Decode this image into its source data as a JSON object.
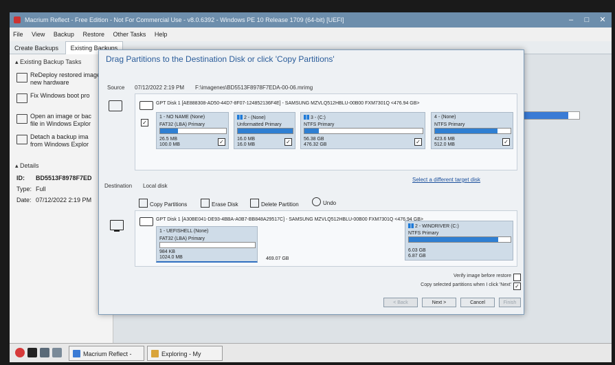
{
  "window": {
    "title": "Macrium Reflect - Free Edition - Not For Commercial Use - v8.0.6392 - Windows PE 10 Release 1709 (64-bit) [UEFI]",
    "controls": [
      "–",
      "□",
      "✕"
    ]
  },
  "menu": [
    "File",
    "View",
    "Backup",
    "Restore",
    "Other Tasks",
    "Help"
  ],
  "ribbon_tabs": [
    "Create Backups",
    "Existing Backups"
  ],
  "left_panel": {
    "tasks_header": "Existing Backup Tasks",
    "tasks": [
      {
        "label": "ReDeploy restored image to",
        "label2": "new hardware"
      },
      {
        "label": "Fix Windows boot pro",
        "label2": ""
      },
      {
        "label": "Open an image or bac",
        "label2": "file in Windows Explor"
      },
      {
        "label": "Detach a backup ima",
        "label2": "from Windows Explor"
      }
    ],
    "details_header": "Details",
    "details": [
      {
        "key": "ID:",
        "value": "BD5513F8978F7ED"
      },
      {
        "key": "Type:",
        "value": "Full"
      },
      {
        "key": "Date:",
        "value": "07/12/2022 2:19 PM"
      }
    ]
  },
  "dialog": {
    "title": "Drag Partitions to the Destination Disk or click 'Copy Partitions'",
    "source": {
      "label": "Source",
      "date": "07/12/2022 2:19 PM",
      "path": "F:\\imagenes\\BD5513F8978F7EDA-00-06.mrimg",
      "disk_info": "GPT Disk 1 [AE888308-AD50-44D7-8F07-124852136F4E] - SAMSUNG MZVLQ512HBLU-00B00 FXM7301Q  <476.94 GB>",
      "partitions": [
        {
          "name": "1 - NO NAME (None)",
          "type": "FAT32 (LBA) Primary",
          "used": "26.5 MB",
          "total": "100.0 MB",
          "fill": 0.27,
          "checked": "✓",
          "win": false
        },
        {
          "name": "2 - (None)",
          "type": "Unformatted Primary",
          "used": "16.0 MB",
          "total": "16.0 MB",
          "fill": 1.0,
          "checked": "✓",
          "win": true
        },
        {
          "name": "3 - (C:)",
          "type": "NTFS Primary",
          "used": "56.38 GB",
          "total": "476.32 GB",
          "fill": 0.12,
          "checked": "✓",
          "win": true
        },
        {
          "name": "4 - (None)",
          "type": "NTFS Primary",
          "used": "423.6 MB",
          "total": "512.0 MB",
          "fill": 0.83,
          "checked": "✓",
          "win": false
        }
      ],
      "disk_checked": "✓"
    },
    "destination": {
      "label": "Destination",
      "target": "Local disk",
      "select_link": "Select a different target disk",
      "toolbar": [
        "Copy Partitions",
        "Erase Disk",
        "Delete Partition",
        "Undo"
      ],
      "disk_info": "GPT Disk 1 [A30BE041-DE93-4BBA-A0B7-BB848A29517C] - SAMSUNG MZVLQ512HBLU-00B00 FXM7301Q  <476.94 GB>",
      "partitions": [
        {
          "name": "1 - UEFISHELL (None)",
          "type": "FAT32 (LBA) Primary",
          "used": "984 KB",
          "total": "1024.0 MB",
          "fill": 0.0
        },
        {
          "name": "2 - WINDRIVER (C:)",
          "type": "NTFS Primary",
          "used": "6.03 GB",
          "total": "6.87 GB",
          "fill": 0.88
        }
      ],
      "unallocated": "469.07 GB"
    },
    "options": {
      "verify": "Verify image before restore",
      "verify_checked": "",
      "copy_selected": "Copy selected partitions when I click 'Next'",
      "copy_checked": "✓"
    },
    "buttons": {
      "back": "< Back",
      "next": "Next >",
      "cancel": "Cancel",
      "finish": "Finish"
    }
  },
  "taskbar": {
    "buttons": [
      "Macrium Reflect - Free ...",
      "Exploring - My Computer"
    ]
  }
}
